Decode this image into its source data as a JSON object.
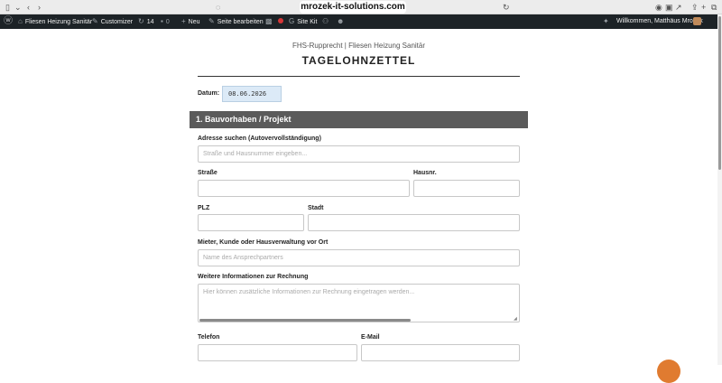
{
  "browser": {
    "url": "mrozek-it-solutions.com"
  },
  "adminbar": {
    "site_name": "Fliesen Heizung Sanitär",
    "customizer": "Customizer",
    "updates": "14",
    "comments": "0",
    "new": "Neu",
    "edit_page": "Seite bearbeiten",
    "site_kit": "Site Kit",
    "greeting": "Willkommen, Matthäus Mrozek"
  },
  "page": {
    "company": "FHS-Rupprecht | Fliesen Heizung Sanitär",
    "title": "TAGELOHNZETTEL"
  },
  "form": {
    "date_label": "Datum:",
    "date_value": "08.06.2026",
    "section1": "1. Bauvorhaben / Projekt",
    "address_search_label": "Adresse suchen (Autovervollständigung)",
    "address_search_placeholder": "Straße und Hausnummer eingeben...",
    "street_label": "Straße",
    "house_number_label": "Hausnr.",
    "zip_label": "PLZ",
    "city_label": "Stadt",
    "contact_label": "Mieter, Kunde oder Hausverwaltung vor Ort",
    "contact_placeholder": "Name des Ansprechpartners",
    "info_label": "Weitere Informationen zur Rechnung",
    "info_placeholder": "Hier können zusätzliche Informationen zur Rechnung eingetragen werden...",
    "phone_label": "Telefon",
    "email_label": "E-Mail"
  },
  "colors": {
    "adminbar": "#1d2327",
    "section_bar": "#5b5b5b",
    "date_bg": "#dceaf7",
    "accent": "#e07b30"
  }
}
